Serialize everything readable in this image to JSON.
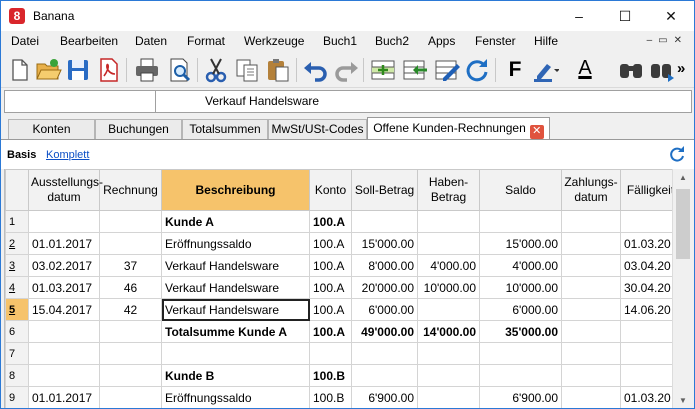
{
  "window": {
    "title": "Banana",
    "logo_glyph": "8"
  },
  "menu": [
    {
      "label": "Datei"
    },
    {
      "label": "Bearbeiten"
    },
    {
      "label": "Daten"
    },
    {
      "label": "Format"
    },
    {
      "label": "Werkzeuge"
    },
    {
      "label": "Buch1"
    },
    {
      "label": "Buch2"
    },
    {
      "label": "Apps"
    },
    {
      "label": "Fenster"
    },
    {
      "label": "Hilfe"
    }
  ],
  "toolbar": {
    "icons": [
      "new-file-icon",
      "open-folder-icon",
      "save-icon",
      "pdf-icon",
      "print-icon",
      "print-preview-icon",
      "cut-icon",
      "copy-icon",
      "paste-icon",
      "undo-icon",
      "redo-icon",
      "add-rows-icon",
      "move-rows-icon",
      "edit-cell-icon",
      "recalculate-icon",
      "bold-icon",
      "highlight-color-icon",
      "text-color-icon",
      "find-icon",
      "find-next-icon"
    ],
    "bold_label": "F",
    "text_color_label": "A",
    "more_label": "»"
  },
  "cellbar": {
    "ref": "",
    "content": "Verkauf Handelsware"
  },
  "tabs": [
    {
      "label": "Konten"
    },
    {
      "label": "Buchungen"
    },
    {
      "label": "Totalsummen"
    },
    {
      "label": "MwSt/USt-Codes"
    },
    {
      "label": "Offene Kunden-Rechnungen",
      "active": true
    }
  ],
  "views": {
    "active": "Basis",
    "other": "Komplett"
  },
  "grid": {
    "columns": [
      "",
      "Ausstellungs-datum",
      "Rechnung",
      "Beschreibung",
      "Konto",
      "Soll-Betrag",
      "Haben-Betrag",
      "Saldo",
      "Zahlungs-datum",
      "Fälligkeit"
    ],
    "rows": [
      {
        "n": "1",
        "cells": [
          "",
          "",
          "Kunde A",
          "100.A",
          "",
          "",
          "",
          "",
          ""
        ],
        "bold": true
      },
      {
        "n": "2",
        "cells": [
          "01.01.2017",
          "",
          "Eröffnungssaldo",
          "100.A",
          "15'000.00",
          "",
          "15'000.00",
          "",
          "01.03.20"
        ]
      },
      {
        "n": "3",
        "cells": [
          "03.02.2017",
          "37",
          "Verkauf Handelsware",
          "100.A",
          "8'000.00",
          "4'000.00",
          "4'000.00",
          "",
          "03.04.20"
        ]
      },
      {
        "n": "4",
        "cells": [
          "01.03.2017",
          "46",
          "Verkauf Handelsware",
          "100.A",
          "20'000.00",
          "10'000.00",
          "10'000.00",
          "",
          "30.04.20"
        ]
      },
      {
        "n": "5",
        "cells": [
          "15.04.2017",
          "42",
          "Verkauf Handelsware",
          "100.A",
          "6'000.00",
          "",
          "6'000.00",
          "",
          "14.06.20"
        ],
        "current": true
      },
      {
        "n": "6",
        "cells": [
          "",
          "",
          "Totalsumme Kunde A",
          "100.A",
          "49'000.00",
          "14'000.00",
          "35'000.00",
          "",
          ""
        ],
        "bold": true
      },
      {
        "n": "7",
        "cells": [
          "",
          "",
          "",
          "",
          "",
          "",
          "",
          "",
          ""
        ]
      },
      {
        "n": "8",
        "cells": [
          "",
          "",
          "Kunde B",
          "100.B",
          "",
          "",
          "",
          "",
          ""
        ],
        "bold": true
      },
      {
        "n": "9",
        "cells": [
          "01.01.2017",
          "",
          "Eröffnungssaldo",
          "100.B",
          "6'900.00",
          "",
          "6'900.00",
          "",
          "01.03.20"
        ]
      }
    ]
  },
  "colors": {
    "accent_orange": "#f6c36b",
    "link_blue": "#0b4fc6",
    "tab_close_red": "#e0533e"
  }
}
